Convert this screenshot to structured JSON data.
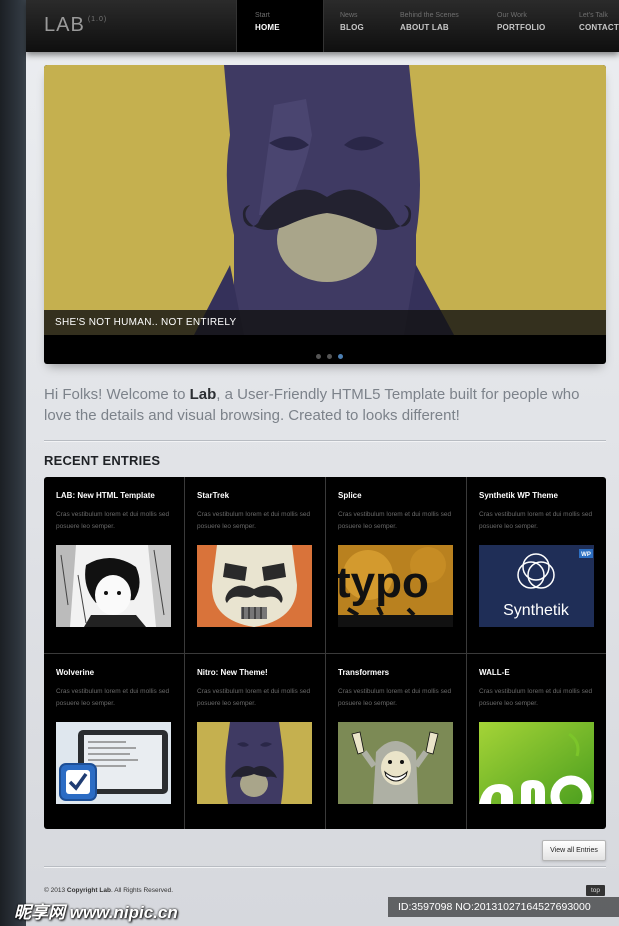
{
  "header": {
    "logo": "LAB",
    "version": "(1.0)",
    "nav": [
      {
        "sub": "Start",
        "label": "HOME"
      },
      {
        "sub": "News",
        "label": "BLOG"
      },
      {
        "sub": "Behind the Scenes",
        "label": "ABOUT LAB"
      },
      {
        "sub": "Our Work",
        "label": "PORTFOLIO"
      },
      {
        "sub": "Let's Talk",
        "label": "CONTACT US"
      }
    ]
  },
  "slider": {
    "caption": "SHE'S NOT HUMAN.. NOT ENTIRELY",
    "active_dot": 3
  },
  "intro": {
    "before": "Hi Folks! Welcome to ",
    "brand": "Lab",
    "after": ", a User-Friendly HTML5 Template built for people who love the details and visual browsing. Created to looks different!"
  },
  "recent": {
    "title": "RECENT ENTRIES",
    "entries": [
      {
        "title": "LAB: New HTML Template",
        "desc": "Cras vestibulum lorem et dui mollis sed posuere leo semper.",
        "thumb": "manga-sketch"
      },
      {
        "title": "StarTrek",
        "desc": "Cras vestibulum lorem et dui mollis sed posuere leo semper.",
        "thumb": "stormtrooper-mustache"
      },
      {
        "title": "Splice",
        "desc": "Cras vestibulum lorem et dui mollis sed posuere leo semper.",
        "thumb": "typo-poster"
      },
      {
        "title": "Synthetik WP Theme",
        "desc": "Cras vestibulum lorem et dui mollis sed posuere leo semper.",
        "thumb": "synthetik-logo",
        "thumb_text": "Synthetik",
        "badge": "WP"
      },
      {
        "title": "Wolverine",
        "desc": "Cras vestibulum lorem et dui mollis sed posuere leo semper.",
        "thumb": "tablet-check"
      },
      {
        "title": "Nitro: New Theme!",
        "desc": "Cras vestibulum lorem et dui mollis sed posuere leo semper.",
        "thumb": "masked-mustache"
      },
      {
        "title": "Transformers",
        "desc": "Cras vestibulum lorem et dui mollis sed posuere leo semper.",
        "thumb": "hooded-grin"
      },
      {
        "title": "WALL-E",
        "desc": "Cras vestibulum lorem et dui mollis sed posuere leo semper.",
        "thumb": "green-lettering"
      }
    ]
  },
  "view_all": "View all Entries",
  "footer": {
    "copyright_prefix": "© 2013 ",
    "copyright_bold": "Copyright Lab",
    "copyright_suffix": ". All Rights Reserved.",
    "top": "top"
  },
  "watermark": {
    "left": "昵享网 www.nipic.cn",
    "right": "ID:3597098 NO:20131027164527693000"
  },
  "colors": {
    "accent": "#4c7fb3",
    "slide_bg": "#c5b04f",
    "mask": "#3f3a63"
  }
}
